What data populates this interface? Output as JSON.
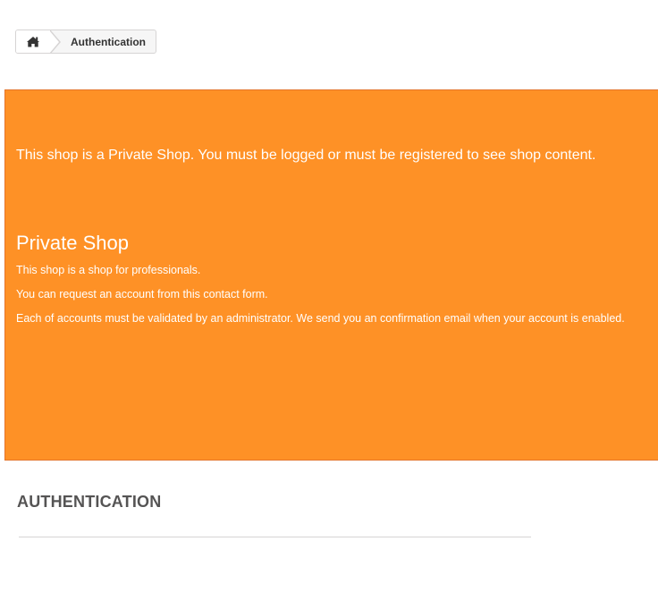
{
  "breadcrumb": {
    "home_icon": "home-icon",
    "current": "Authentication"
  },
  "banner": {
    "message": "This shop is a Private Shop. You must be logged or must be registered to see shop content.",
    "title": "Private Shop",
    "lines": [
      "This shop is a shop for professionals.",
      "You can request an account from this contact form.",
      "Each of accounts must be validated by an administrator. We send you an confirmation email when your account is enabled."
    ],
    "background_color": "#fe9126"
  },
  "page": {
    "heading": "AUTHENTICATION"
  }
}
